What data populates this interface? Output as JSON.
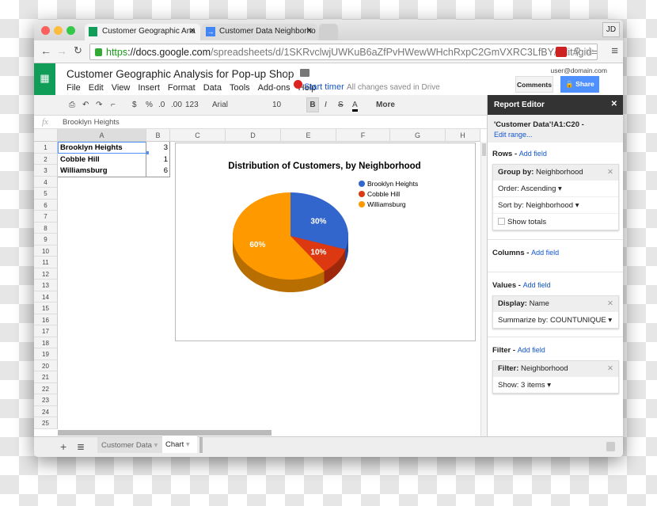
{
  "browser": {
    "tabs": [
      {
        "label": "Customer Geographic Ana"
      },
      {
        "label": "Customer Data Neighborho"
      }
    ],
    "profile": "JD",
    "url_scheme": "https",
    "url_host": "://docs.google.com",
    "url_path": "/spreadsheets/d/1SKRvclwjUWKuB6aZfPvHWewWHchRxpC2GmVXRC3LfBY/edit#gid=..."
  },
  "doc": {
    "title": "Customer Geographic Analysis for Pop-up Shop",
    "user": "user@domain.com",
    "comments": "Comments",
    "share": "Share",
    "menu": [
      "File",
      "Edit",
      "View",
      "Insert",
      "Format",
      "Data",
      "Tools",
      "Add-ons",
      "Help"
    ],
    "timer": "Start timer",
    "status": "All changes saved in Drive"
  },
  "toolbar": {
    "dollar": "$",
    "percent": "%",
    "dec_less": ".0",
    "dec_more": ".00",
    "format": "123",
    "font": "Arial",
    "size": "10",
    "bold": "B",
    "italic": "I",
    "strike": "S",
    "color": "A",
    "more": "More"
  },
  "formula": {
    "fx": "fx",
    "value": "Brooklyn Heights"
  },
  "columns": [
    "A",
    "B",
    "C",
    "D",
    "E",
    "F",
    "G",
    "H"
  ],
  "rows": [
    "1",
    "2",
    "3",
    "4",
    "5",
    "6",
    "7",
    "8",
    "9",
    "10",
    "11",
    "12",
    "13",
    "14",
    "15",
    "16",
    "17",
    "18",
    "19",
    "20",
    "21",
    "22",
    "23",
    "24",
    "25"
  ],
  "cells": [
    {
      "name": "Brooklyn Heights",
      "count": "3"
    },
    {
      "name": "Cobble Hill",
      "count": "1"
    },
    {
      "name": "Williamsburg",
      "count": "6"
    }
  ],
  "chart_data": {
    "type": "pie",
    "title": "Distribution of Customers, by Neighborhood",
    "categories": [
      "Brooklyn Heights",
      "Cobble Hill",
      "Williamsburg"
    ],
    "values": [
      3,
      1,
      6
    ],
    "labels": [
      "30%",
      "10%",
      "60%"
    ],
    "colors": [
      "#3366cc",
      "#dc3912",
      "#ff9900"
    ],
    "legend": "right",
    "style": "3d"
  },
  "report": {
    "title": "Report Editor",
    "range": "'Customer Data'!A1:C20 -",
    "edit_range": "Edit range...",
    "rows_label": "Rows",
    "columns_label": "Columns",
    "values_label": "Values",
    "filter_label": "Filter",
    "add_field": "Add field",
    "group_key": "Group by:",
    "group_val": "Neighborhood",
    "order": "Order: Ascending",
    "sort": "Sort by: Neighborhood",
    "totals": "Show totals",
    "display_key": "Display:",
    "display_val": "Name",
    "summarize": "Summarize by: COUNTUNIQUE",
    "filter_key": "Filter:",
    "filter_val": "Neighborhood",
    "show": "Show: 3 items"
  },
  "sheets": [
    {
      "label": "Customer Data"
    },
    {
      "label": "Chart"
    }
  ]
}
